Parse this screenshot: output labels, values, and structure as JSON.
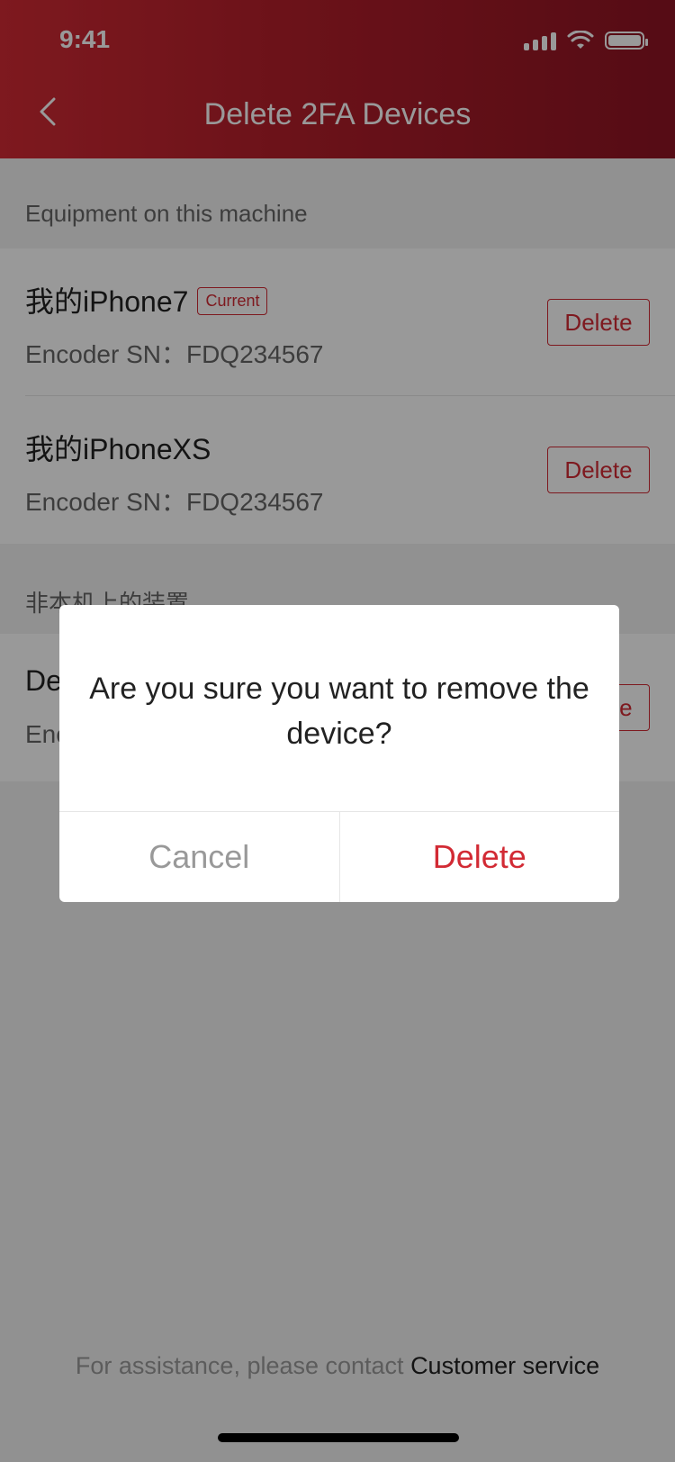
{
  "status_bar": {
    "time": "9:41"
  },
  "header": {
    "title": "Delete 2FA Devices"
  },
  "sections": [
    {
      "title": "Equipment on this machine",
      "devices": [
        {
          "name": "我的iPhone7",
          "tag": "Current",
          "sn": "Encoder SN：FDQ234567",
          "delete_label": "Delete"
        },
        {
          "name": "我的iPhoneXS",
          "sn": "Encoder SN：FDQ234567",
          "delete_label": "Delete"
        }
      ]
    },
    {
      "title": "非本机上的装置",
      "devices": [
        {
          "name": "De",
          "sn": "Enc",
          "delete_label": "Delete"
        }
      ]
    }
  ],
  "footer": {
    "text": "For assistance, please contact ",
    "link": "Customer service"
  },
  "dialog": {
    "message": "Are you sure you want to remove the device?",
    "cancel_label": "Cancel",
    "confirm_label": "Delete"
  },
  "colors": {
    "accent": "#d22a34",
    "header_dark": "#8e1423"
  },
  "icons": [
    "back-chevron-icon",
    "signal-icon",
    "wifi-icon",
    "battery-icon"
  ]
}
